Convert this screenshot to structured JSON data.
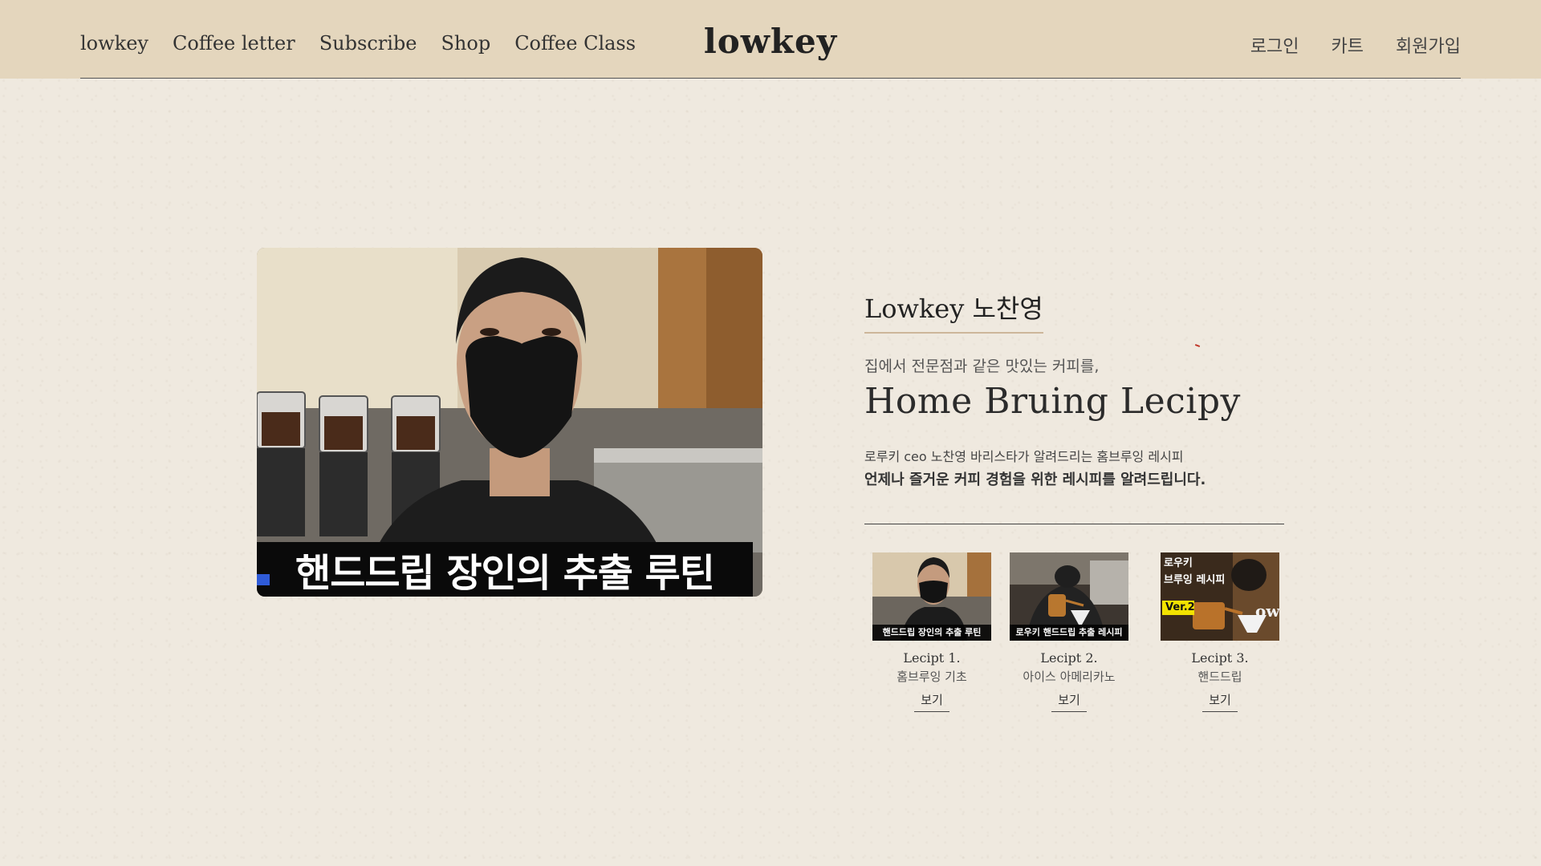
{
  "header": {
    "nav_left": [
      "lowkey",
      "Coffee letter",
      "Subscribe",
      "Shop",
      "Coffee Class"
    ],
    "brand": "lowkey",
    "nav_right": [
      "로그인",
      "카트",
      "회원가입"
    ]
  },
  "video": {
    "caption": "핸드드립 장인의 추출 루틴"
  },
  "intro": {
    "name": "Lowkey 노찬영",
    "subtitle": "집에서 전문점과 같은 맛있는 커피를,",
    "headline": "Home Bruing Lecipy",
    "desc_line1": "로루키 ceo 노찬영 바리스타가 알려드리는 홈브루잉 레시피",
    "desc_line2": "언제나 즐거운 커피 경험을 위한 레시피를 알려드립니다."
  },
  "recipes": [
    {
      "thumb_caption": "핸드드립 장인의 추출 루틴",
      "title": "Lecipt 1.",
      "subtitle": "홈브루잉 기초",
      "action": "보기"
    },
    {
      "thumb_caption": "로우키 핸드드립 추출 레시피",
      "title": "Lecipt 2.",
      "subtitle": "아이스 아메리카노",
      "action": "보기"
    },
    {
      "thumb_tag_1": "로우키",
      "thumb_tag_2": "브루잉 레시피",
      "thumb_tag_3": "Ver.2",
      "thumb_logo": "owk",
      "title": "Lecipt 3.",
      "subtitle": "핸드드립",
      "action": "보기"
    }
  ],
  "colors": {
    "header_bg": "#e4d6bd",
    "page_bg": "#efe9df",
    "name_underline": "#cdb69a",
    "tag_yellow": "#f2e200"
  }
}
